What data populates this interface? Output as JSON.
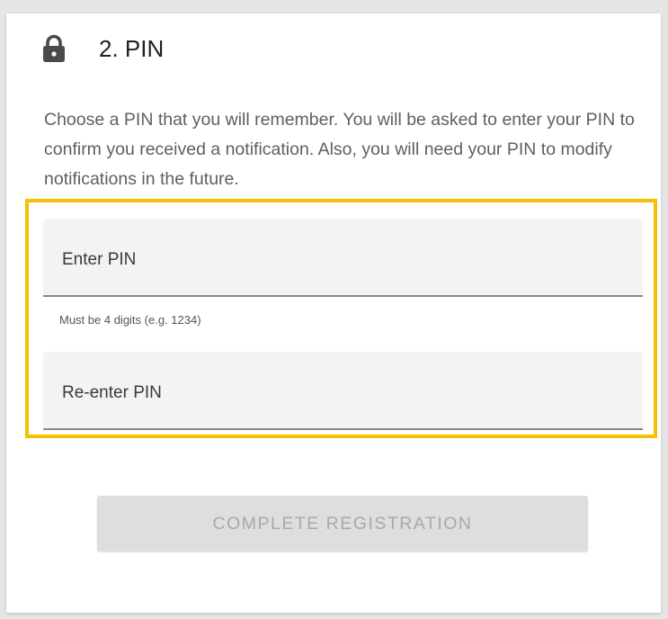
{
  "section": {
    "title": "2. PIN",
    "description": "Choose a PIN that you will remember. You will be asked to enter your PIN to confirm you received a notification. Also, you will need your PIN to modify notifications in the future."
  },
  "icons": {
    "header_icon": "lock-icon"
  },
  "form": {
    "pin_placeholder": "Enter PIN",
    "pin_value": "",
    "pin_hint": "Must be 4 digits (e.g. 1234)",
    "repin_placeholder": "Re-enter PIN",
    "repin_value": ""
  },
  "actions": {
    "submit_label": "COMPLETE REGISTRATION",
    "submit_disabled": true
  },
  "colors": {
    "highlight": "#f5c003",
    "field_background": "#f3f3f3",
    "button_background": "#dedede",
    "button_text": "#a9a9a9"
  }
}
